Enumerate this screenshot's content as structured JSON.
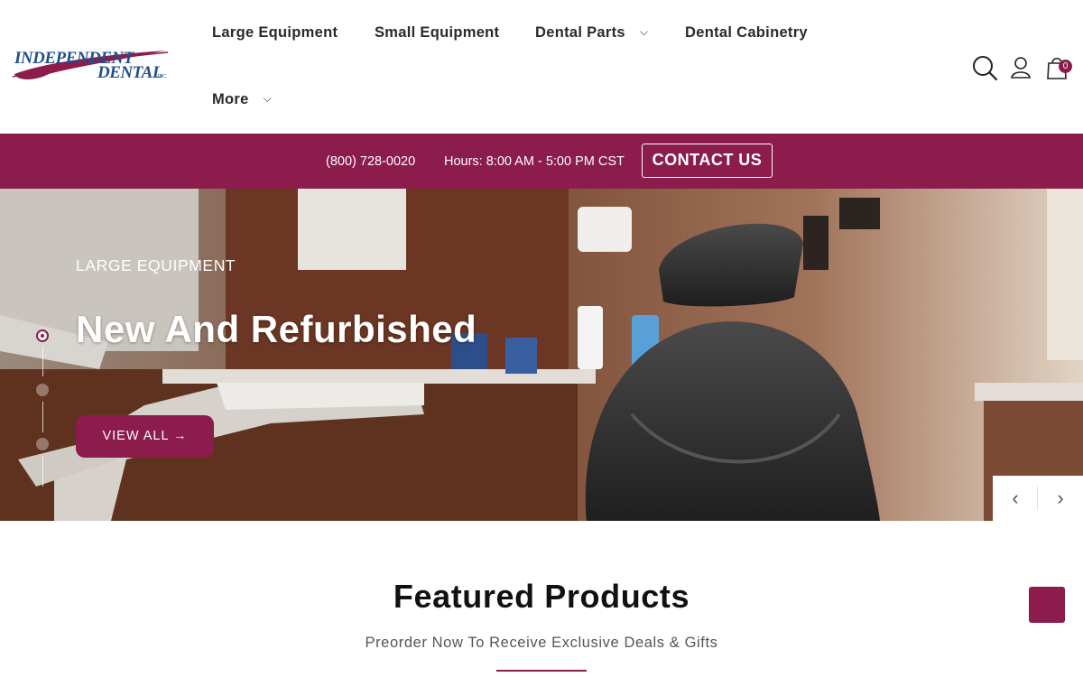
{
  "brand": {
    "logo_line1": "INDEPENDENT",
    "logo_line2": "DENTAL",
    "logo_suffix": "INC.",
    "primary_color": "#8c1c4c",
    "logo_blue": "#1f4f8a"
  },
  "nav": {
    "items": [
      {
        "label": "Large Equipment"
      },
      {
        "label": "Small Equipment"
      },
      {
        "label": "Dental Parts",
        "has_dropdown": true
      },
      {
        "label": "Dental Cabinetry"
      },
      {
        "label": "More",
        "has_dropdown": true
      }
    ],
    "chevron": "⌵"
  },
  "header_icons": {
    "search": "search-icon",
    "account": "user-icon",
    "cart": "shopping-bag-icon",
    "cart_count": "0"
  },
  "announcement": {
    "phone": "(800) 728-0020",
    "hours": "Hours: 8:00 AM - 5:00 PM CST",
    "contact_label": "CONTACT US"
  },
  "hero": {
    "eyebrow": "LARGE EQUIPMENT",
    "headline": "New And Refurbished",
    "cta_label": "VIEW ALL →",
    "slide_count": 3,
    "active_slide": 1,
    "prev_label": "‹",
    "next_label": "›"
  },
  "featured": {
    "title": "Featured Products",
    "subtitle": "Preorder Now To Receive Exclusive Deals & Gifts"
  }
}
